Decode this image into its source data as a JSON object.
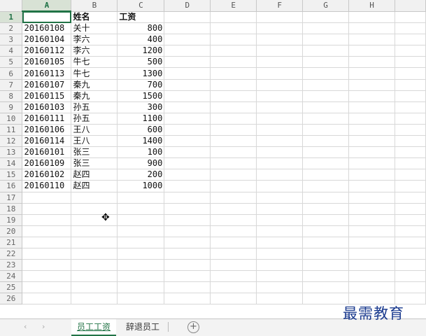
{
  "columns": [
    "A",
    "B",
    "C",
    "D",
    "E",
    "F",
    "G",
    "H"
  ],
  "row_numbers": [
    "1",
    "2",
    "3",
    "4",
    "5",
    "6",
    "7",
    "8",
    "9",
    "10",
    "11",
    "12",
    "13",
    "14",
    "15",
    "16",
    "17",
    "18",
    "19",
    "20",
    "21",
    "22",
    "23",
    "24",
    "25",
    "26"
  ],
  "header_row": {
    "a": "",
    "b": "姓名",
    "c": "工资"
  },
  "rows": [
    {
      "a": "20160108",
      "b": "关十",
      "c": "800"
    },
    {
      "a": "20160104",
      "b": "李六",
      "c": "400"
    },
    {
      "a": "20160112",
      "b": "李六",
      "c": "1200"
    },
    {
      "a": "20160105",
      "b": "牛七",
      "c": "500"
    },
    {
      "a": "20160113",
      "b": "牛七",
      "c": "1300"
    },
    {
      "a": "20160107",
      "b": "秦九",
      "c": "700"
    },
    {
      "a": "20160115",
      "b": "秦九",
      "c": "1500"
    },
    {
      "a": "20160103",
      "b": "孙五",
      "c": "300"
    },
    {
      "a": "20160111",
      "b": "孙五",
      "c": "1100"
    },
    {
      "a": "20160106",
      "b": "王八",
      "c": "600"
    },
    {
      "a": "20160114",
      "b": "王八",
      "c": "1400"
    },
    {
      "a": "20160101",
      "b": "张三",
      "c": "100"
    },
    {
      "a": "20160109",
      "b": "张三",
      "c": "900"
    },
    {
      "a": "20160102",
      "b": "赵四",
      "c": "200"
    },
    {
      "a": "20160110",
      "b": "赵四",
      "c": "1000"
    }
  ],
  "empty_rows": 10,
  "tabs": [
    {
      "label": "员工工资",
      "active": true
    },
    {
      "label": "辞退员工",
      "active": false
    }
  ],
  "nav": {
    "prev": "‹",
    "next": "›",
    "add": "+"
  },
  "watermark": "最需教育",
  "cursor_icon": "move-cross-icon",
  "accent_color": "#217346"
}
